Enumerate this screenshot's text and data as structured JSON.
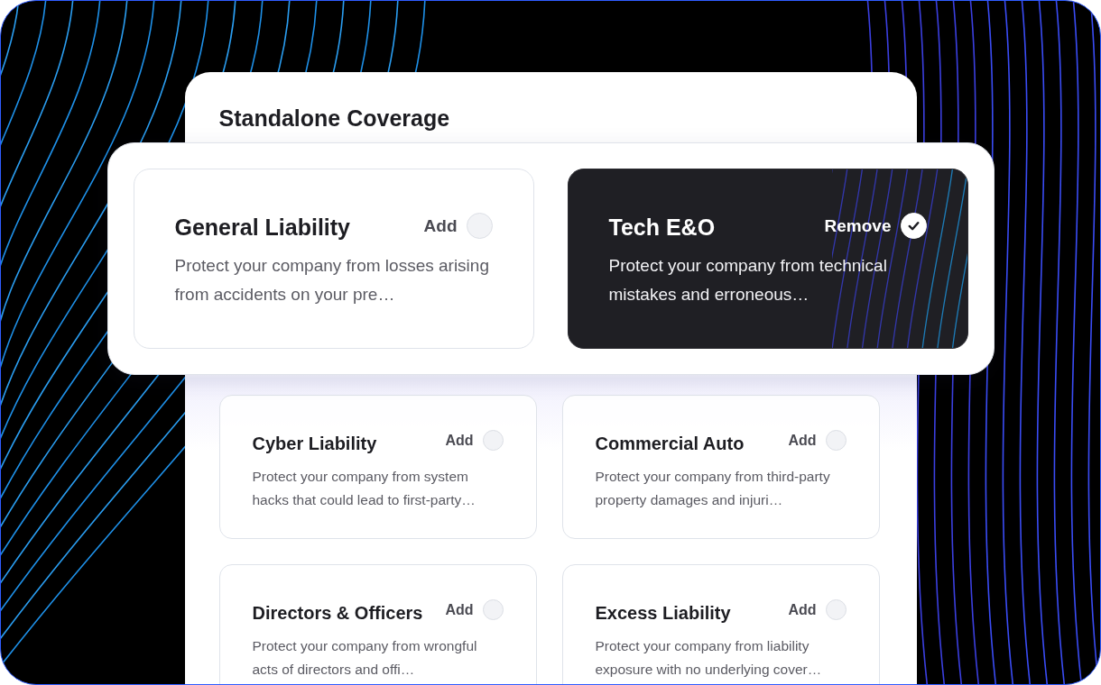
{
  "panel": {
    "title": "Standalone Coverage"
  },
  "featured": [
    {
      "title": "General Liability",
      "description": "Protect your company from losses arising from accidents on your pre…",
      "action": "Add",
      "selected": false
    },
    {
      "title": "Tech E&O",
      "description": "Protect your company from technical mistakes and erroneous…",
      "action": "Remove",
      "selected": true
    }
  ],
  "coverages": [
    {
      "title": "Cyber Liability",
      "description": "Protect your company from system hacks that could lead to first-party…",
      "action": "Add",
      "selected": false
    },
    {
      "title": "Commercial Auto",
      "description": "Protect your company from third-party property damages and injuri…",
      "action": "Add",
      "selected": false
    },
    {
      "title": "Directors & Officers",
      "description": "Protect your company from wrongful acts of directors and offi…",
      "action": "Add",
      "selected": false
    },
    {
      "title": "Excess Liability",
      "description": "Protect your company from liability exposure with no underlying cover…",
      "action": "Add",
      "selected": false
    }
  ]
}
